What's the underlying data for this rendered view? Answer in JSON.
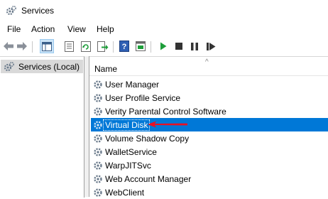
{
  "window": {
    "title": "Services"
  },
  "menu": {
    "file": "File",
    "action": "Action",
    "view": "View",
    "help": "Help"
  },
  "toolbar": {
    "buttons": [
      "back-arrow-icon",
      "forward-arrow-icon",
      "show-hide-tree-icon",
      "properties-icon",
      "refresh-icon",
      "export-list-icon",
      "help-icon",
      "console-view-icon",
      "start-service-icon",
      "stop-service-icon",
      "pause-service-icon",
      "restart-service-icon"
    ]
  },
  "tree": {
    "root": "Services (Local)"
  },
  "list": {
    "column_name": "Name",
    "sort_indicator": "^",
    "rows": [
      "User Manager",
      "User Profile Service",
      "Verity Parental Control Software",
      "Virtual Disk",
      "Volume Shadow Copy",
      "WalletService",
      "WarpJITSvc",
      "Web Account Manager",
      "WebClient"
    ],
    "selected_row": "Virtual Disk"
  },
  "colors": {
    "selection": "#0078d7",
    "annotation_arrow": "#e81123",
    "play_green": "#1e9e3a"
  }
}
